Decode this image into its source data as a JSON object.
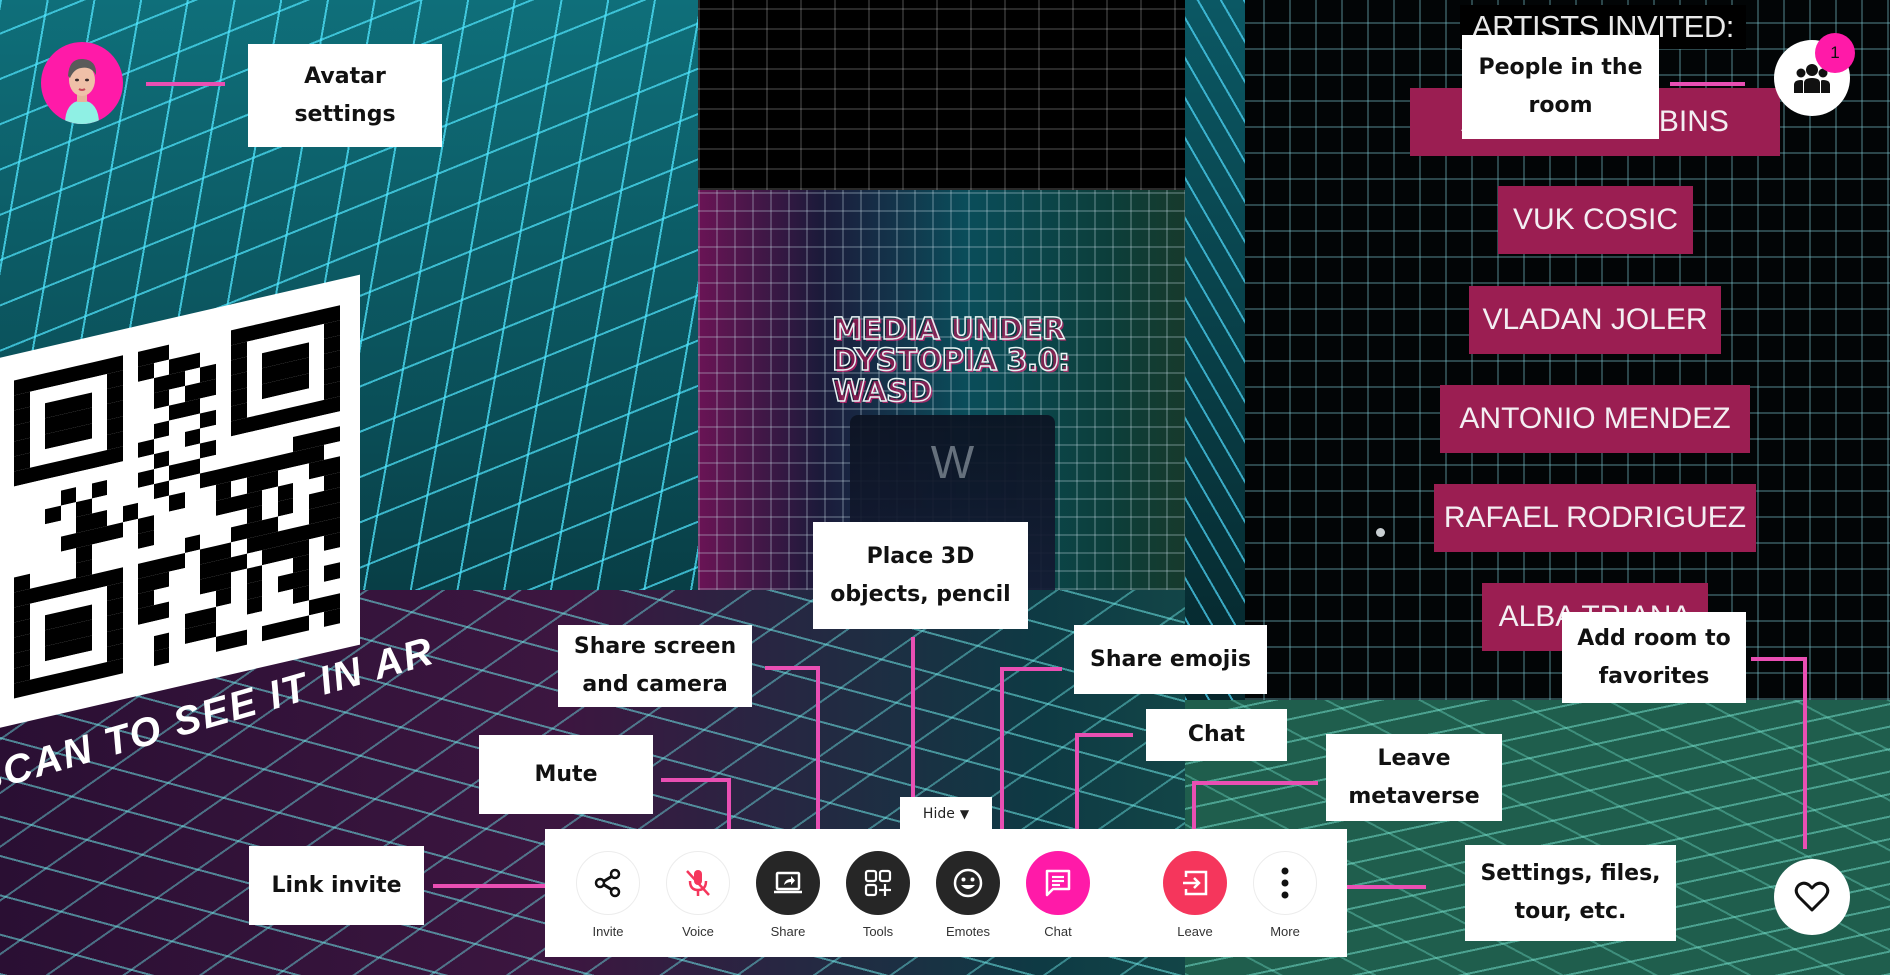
{
  "scene": {
    "room_title": "MEDIA UNDER DYSTOPIA 3.0: WASD",
    "key_letter": "W",
    "qr_caption": "SCAN TO SEE IT IN AR",
    "artists_header": "ARTISTS INVITED:",
    "artists": [
      "ARTHUR ROBBINS",
      "VUK COSIC",
      "VLADAN JOLER",
      "ANTONIO MENDEZ",
      "RAFAEL RODRIGUEZ",
      "ALBA TRIANA"
    ]
  },
  "hud": {
    "avatar_icon": "avatar-portrait",
    "people_icon": "people-group",
    "people_count": "1",
    "favorite_icon": "heart-outline"
  },
  "toolbar": {
    "hide_label": "Hide",
    "hide_icon": "▼",
    "buttons": [
      {
        "id": "invite",
        "label": "Invite",
        "icon": "share-nodes",
        "style": "light"
      },
      {
        "id": "voice",
        "label": "Voice",
        "icon": "mic-off",
        "style": "light"
      },
      {
        "id": "share",
        "label": "Share",
        "icon": "screen-share",
        "style": "dark"
      },
      {
        "id": "tools",
        "label": "Tools",
        "icon": "grid-plus",
        "style": "dark"
      },
      {
        "id": "emotes",
        "label": "Emotes",
        "icon": "smiley",
        "style": "dark"
      },
      {
        "id": "chat",
        "label": "Chat",
        "icon": "chat-bubble",
        "style": "pink"
      },
      {
        "id": "leave",
        "label": "Leave",
        "icon": "exit-arrow",
        "style": "red"
      },
      {
        "id": "more",
        "label": "More",
        "icon": "vertical-dots",
        "style": "light"
      }
    ]
  },
  "callouts": {
    "avatar_settings": "Avatar\nsettings",
    "people_in_room": "People in the\nroom",
    "place_3d": "Place 3D\nobjects, pencil",
    "share_screen": "Share screen\nand camera",
    "share_emojis": "Share emojis",
    "add_favorites": "Add room to\nfavorites",
    "chat": "Chat",
    "leave_metaverse": "Leave\nmetaverse",
    "mute": "Mute",
    "link_invite": "Link invite",
    "settings_more": "Settings, files,\ntour, etc."
  },
  "colors": {
    "accent_pink": "#ff1aa8",
    "leave_red": "#f5365c",
    "callout_line": "#e94fb3",
    "artist_tag": "#9b1e52",
    "dark_button": "#262626"
  }
}
